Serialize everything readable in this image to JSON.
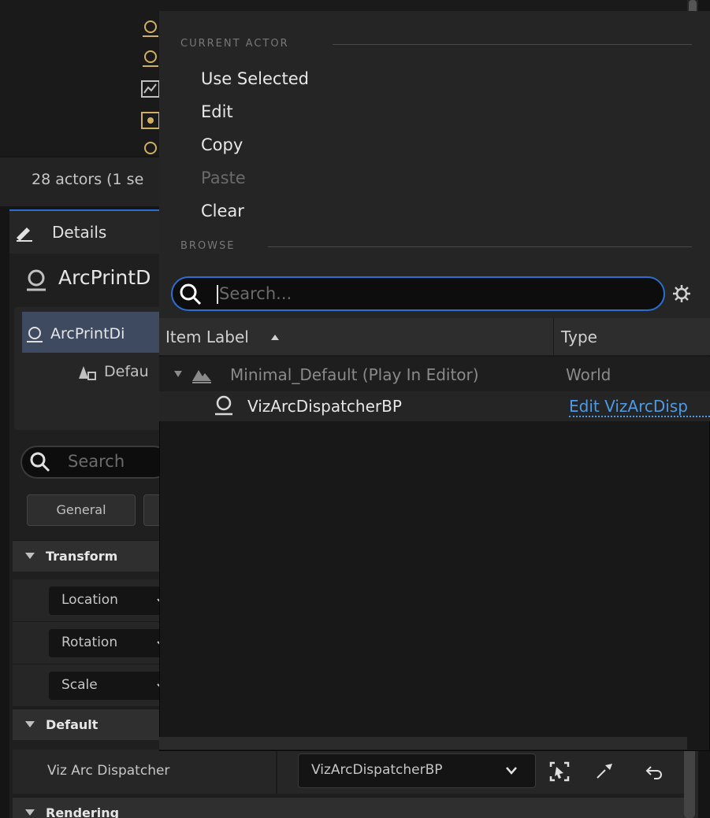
{
  "outliner": {
    "actor_count": "28 actors (1 se",
    "actor_icons": [
      "actor-icon",
      "actor-icon",
      "graph-icon",
      "target-icon",
      "actor-icon"
    ]
  },
  "details": {
    "tab_label": "Details",
    "actor_name": "ArcPrintD",
    "component_selected": "ArcPrintDi",
    "component_sub": "Defau",
    "search_placeholder": "Search",
    "filters": [
      "General",
      ""
    ],
    "categories": {
      "transform": "Transform",
      "default": "Default",
      "rendering": "Rendering"
    },
    "transform_rows": [
      "Location",
      "Rotation",
      "Scale"
    ],
    "property": {
      "label": "Viz Arc Dispatcher",
      "value": "VizArcDispatcherBP"
    }
  },
  "popup": {
    "section_current": "CURRENT ACTOR",
    "menu": [
      {
        "label": "Use Selected",
        "enabled": true
      },
      {
        "label": "Edit",
        "enabled": true
      },
      {
        "label": "Copy",
        "enabled": true
      },
      {
        "label": "Paste",
        "enabled": false
      },
      {
        "label": "Clear",
        "enabled": true
      }
    ],
    "section_browse": "BROWSE",
    "search_placeholder": "Search...",
    "columns": {
      "label": "Item Label",
      "type": "Type"
    },
    "rows": [
      {
        "label": "Minimal_Default (Play In Editor)",
        "type": "World"
      },
      {
        "label": "VizArcDispatcherBP",
        "type": "Edit VizArcDisp"
      }
    ]
  },
  "colors": {
    "accent": "#2a6fcf",
    "link": "#4d9ae6",
    "selection": "#3d4a60"
  }
}
